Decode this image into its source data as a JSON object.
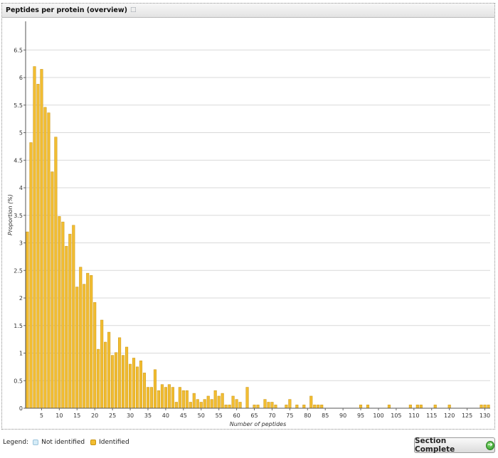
{
  "panel": {
    "title": "Peptides per protein (overview)"
  },
  "legend": {
    "title": "Legend:",
    "items": [
      {
        "label": "Not identified",
        "color": "#d6ecf7",
        "border": "#9cc4dc"
      },
      {
        "label": "Identified",
        "color": "#f2bd31",
        "border": "#c89310"
      }
    ]
  },
  "footer": {
    "section_complete_label": "Section Complete",
    "section_complete_icon": "arrow-right-circle-icon"
  },
  "chart_data": {
    "type": "bar",
    "xlabel": "Number of peptides",
    "ylabel": "Proportion (%)",
    "ylim": [
      0,
      6.5
    ],
    "yticks": [
      0,
      0.5,
      1,
      1.5,
      2,
      2.5,
      3,
      3.5,
      4,
      4.5,
      5,
      5.5,
      6,
      6.5
    ],
    "xlim": [
      1,
      131
    ],
    "xticks": [
      5,
      10,
      15,
      20,
      25,
      30,
      35,
      40,
      45,
      50,
      55,
      60,
      65,
      70,
      75,
      80,
      85,
      90,
      95,
      100,
      105,
      110,
      115,
      120,
      125,
      130
    ],
    "grid": true,
    "bar_color": "#f2bd31",
    "bar_edge_color": "#c89310",
    "series": [
      {
        "name": "Identified",
        "x": [
          1,
          2,
          3,
          4,
          5,
          6,
          7,
          8,
          9,
          10,
          11,
          12,
          13,
          14,
          15,
          16,
          17,
          18,
          19,
          20,
          21,
          22,
          23,
          24,
          25,
          26,
          27,
          28,
          29,
          30,
          31,
          32,
          33,
          34,
          35,
          36,
          37,
          38,
          39,
          40,
          41,
          42,
          43,
          44,
          45,
          46,
          47,
          48,
          49,
          50,
          51,
          52,
          53,
          54,
          55,
          56,
          57,
          58,
          59,
          60,
          61,
          63,
          65,
          66,
          68,
          69,
          70,
          71,
          74,
          75,
          77,
          79,
          81,
          82,
          83,
          84,
          95,
          97,
          103,
          109,
          111,
          112,
          116,
          120,
          129,
          130,
          131
        ],
        "values": [
          3.2,
          4.82,
          6.2,
          5.88,
          6.15,
          5.46,
          5.36,
          4.29,
          4.92,
          3.48,
          3.38,
          2.94,
          3.16,
          3.32,
          2.2,
          2.56,
          2.25,
          2.45,
          2.41,
          1.92,
          1.07,
          1.6,
          1.2,
          1.38,
          0.96,
          1.01,
          1.28,
          0.96,
          1.11,
          0.8,
          0.91,
          0.75,
          0.86,
          0.64,
          0.38,
          0.38,
          0.7,
          0.32,
          0.43,
          0.38,
          0.43,
          0.38,
          0.11,
          0.38,
          0.32,
          0.32,
          0.11,
          0.27,
          0.16,
          0.11,
          0.16,
          0.22,
          0.16,
          0.32,
          0.22,
          0.27,
          0.06,
          0.06,
          0.22,
          0.16,
          0.11,
          0.38,
          0.06,
          0.06,
          0.16,
          0.11,
          0.11,
          0.06,
          0.06,
          0.16,
          0.06,
          0.06,
          0.22,
          0.06,
          0.06,
          0.06,
          0.06,
          0.06,
          0.06,
          0.06,
          0.06,
          0.06,
          0.06,
          0.06,
          0.06,
          0.06,
          0.06
        ]
      }
    ]
  }
}
